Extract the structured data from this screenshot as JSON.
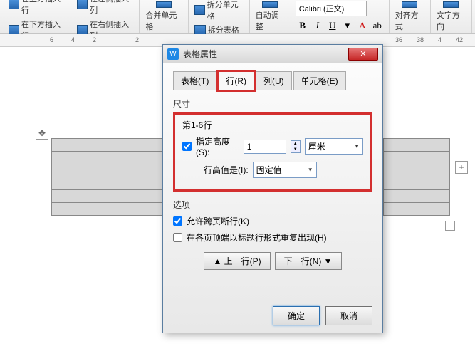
{
  "ribbon": {
    "insert_row_above": "在上方插入行",
    "insert_row_below": "在下方插入行",
    "insert_col_left": "在左侧插入列",
    "insert_col_right": "在右侧插入列",
    "merge_cells": "合并单元格",
    "split_cells": "拆分单元格",
    "split_table": "拆分表格",
    "autofit": "自动调整",
    "font_name": "Calibri (正文)",
    "align": "对齐方式",
    "text_dir": "文字方向"
  },
  "ruler": {
    "marks": [
      "6",
      "4",
      "2",
      "",
      "2",
      "36",
      "38",
      "4",
      "42"
    ]
  },
  "dialog": {
    "title": "表格属性",
    "tabs": {
      "table": "表格(T)",
      "row": "行(R)",
      "column": "列(U)",
      "cell": "单元格(E)"
    },
    "size_label": "尺寸",
    "rows_range": "第1-6行",
    "specify_height": "指定高度(S):",
    "height_value": "1",
    "height_unit": "厘米",
    "height_is_label": "行高值是(I):",
    "height_is_value": "固定值",
    "options_label": "选项",
    "allow_break": "允许跨页断行(K)",
    "repeat_header": "在各页顶端以标题行形式重复出现(H)",
    "prev_row": "▲ 上一行(P)",
    "next_row": "下一行(N) ▼",
    "ok": "确定",
    "cancel": "取消"
  }
}
